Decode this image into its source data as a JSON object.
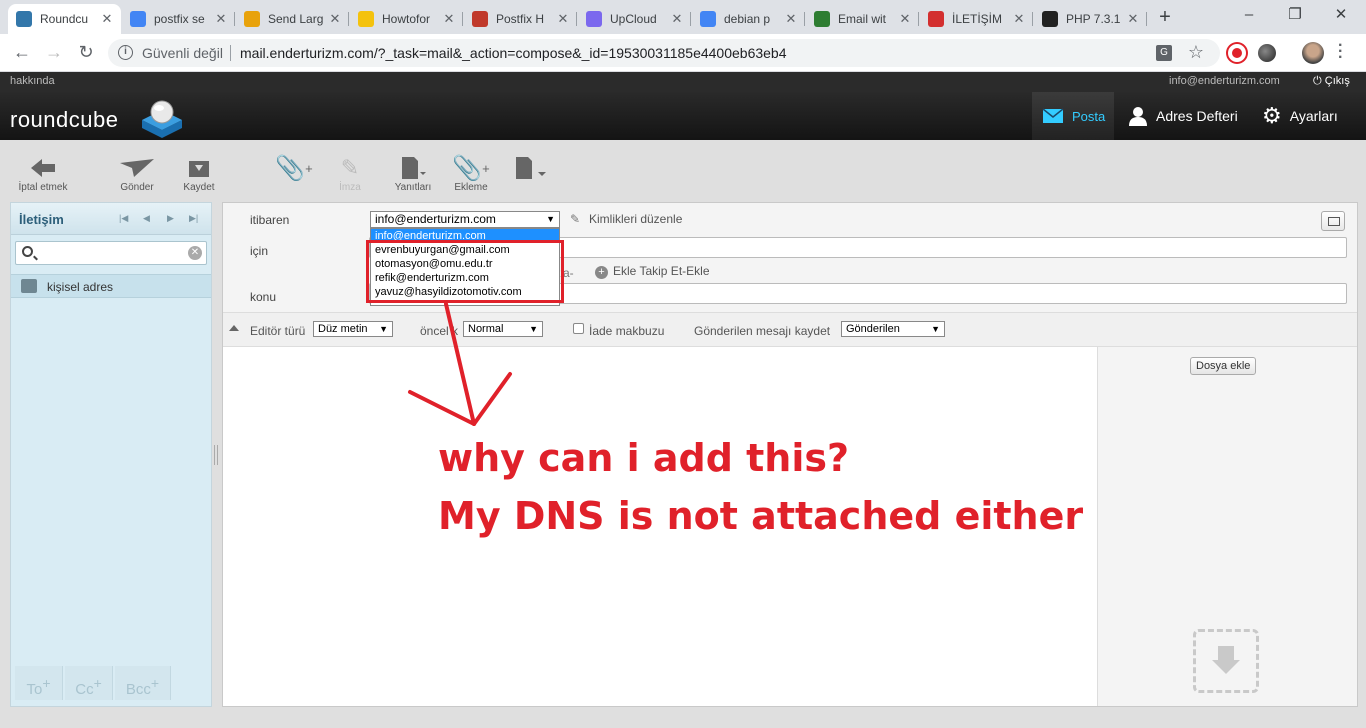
{
  "browser": {
    "tabs": [
      {
        "title": "Roundcu",
        "active": true,
        "favicon_color": "#37a"
      },
      {
        "title": "postfix se",
        "favicon_color": "#4285f4"
      },
      {
        "title": "Send Larg",
        "favicon_color": "#e8a20b"
      },
      {
        "title": "Howtofor",
        "favicon_color": "#f4c20d"
      },
      {
        "title": "Postfix H",
        "favicon_color": "#c0392b"
      },
      {
        "title": "UpCloud",
        "favicon_color": "#7b68ee"
      },
      {
        "title": "debian p",
        "favicon_color": "#4285f4"
      },
      {
        "title": "Email wit",
        "favicon_color": "#2e7d32"
      },
      {
        "title": "İLETİŞİM",
        "favicon_color": "#d32f2f"
      },
      {
        "title": "PHP 7.3.1",
        "favicon_color": "#222"
      }
    ],
    "insecure_label": "Güvenli değil",
    "url": "mail.enderturizm.com/?_task=mail&_action=compose&_id=19530031185e4400eb63eb4"
  },
  "rc": {
    "about": "hakkında",
    "user": "info@enderturizm.com",
    "logout": "Çıkış",
    "logo": "roundcube",
    "nav": {
      "mail": "Posta",
      "contacts": "Adres Defteri",
      "settings": "Ayarları"
    },
    "toolbar": {
      "cancel": "İptal etmek",
      "send": "Gönder",
      "save": "Kaydet",
      "signature": "İmza",
      "responses": "Yanıtları",
      "attach": "Ekleme"
    },
    "contacts_title": "İletişim",
    "addressbook_label": "kişisel adres",
    "recipient_buttons": [
      "To",
      "Cc",
      "Bcc"
    ],
    "headers": {
      "from_label": "itibaren",
      "from_value": "info@enderturizm.com",
      "edit_identities": "Kimlikleri düzenle",
      "to_label": "için",
      "followup_prefix": "tla-",
      "add_followup": "Ekle Takip Et-Ekle",
      "subject_label": "konu"
    },
    "from_options": [
      "info@enderturizm.com",
      "evrenbuyurgan@gmail.com",
      "otomasyon@omu.edu.tr",
      "refik@enderturizm.com",
      "yavuz@hasyildizotomotiv.com"
    ],
    "options": {
      "editor_type_label": "Editör türü",
      "editor_type_value": "Düz metin",
      "priority_label": "öncel k",
      "priority_value": "Normal",
      "receipt_label": "İade makbuzu",
      "save_sent_label": "Gönderilen mesajı kaydet",
      "save_sent_value": "Gönderilen"
    },
    "attach_button": "Dosya ekle"
  },
  "annotation": {
    "line1": "why can i add this?",
    "line2": "My DNS is not attached either",
    "color": "#e0212a"
  }
}
